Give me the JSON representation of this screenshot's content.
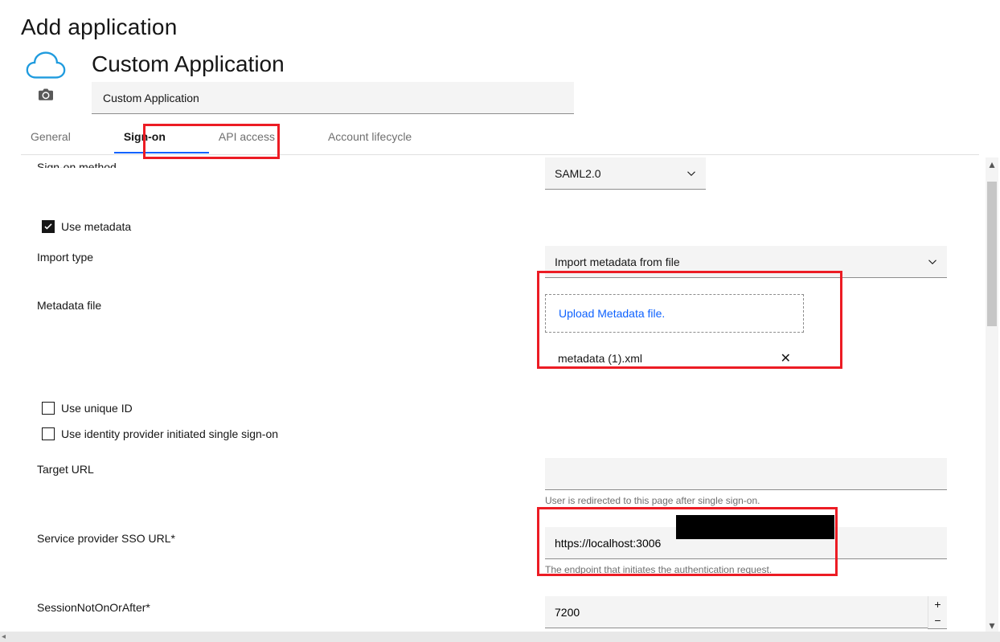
{
  "page_title": "Add application",
  "app_name_heading": "Custom Application",
  "app_name_value": "Custom Application",
  "tabs": [
    "General",
    "Sign-on",
    "API access",
    "Account lifecycle"
  ],
  "active_tab_index": 1,
  "truncated_label": "Sign-on method",
  "sign_on_method_value": "SAML2.0",
  "use_metadata": {
    "label": "Use metadata",
    "checked": true
  },
  "import_type": {
    "label": "Import type",
    "value": "Import metadata from file"
  },
  "metadata_file": {
    "label": "Metadata file",
    "upload_prompt": "Upload Metadata file.",
    "filename": "metadata (1).xml"
  },
  "use_unique_id": {
    "label": "Use unique ID",
    "checked": false
  },
  "use_idp_sso": {
    "label": "Use identity provider initiated single sign-on",
    "checked": false
  },
  "target_url": {
    "label": "Target URL",
    "value": "",
    "helper": "User is redirected to this page after single sign-on."
  },
  "sp_sso_url": {
    "label": "Service provider SSO URL*",
    "value": "https://localhost:3006",
    "helper": "The endpoint that initiates the authentication request."
  },
  "session_not_on_or_after": {
    "label": "SessionNotOnOrAfter*",
    "value": "7200"
  }
}
